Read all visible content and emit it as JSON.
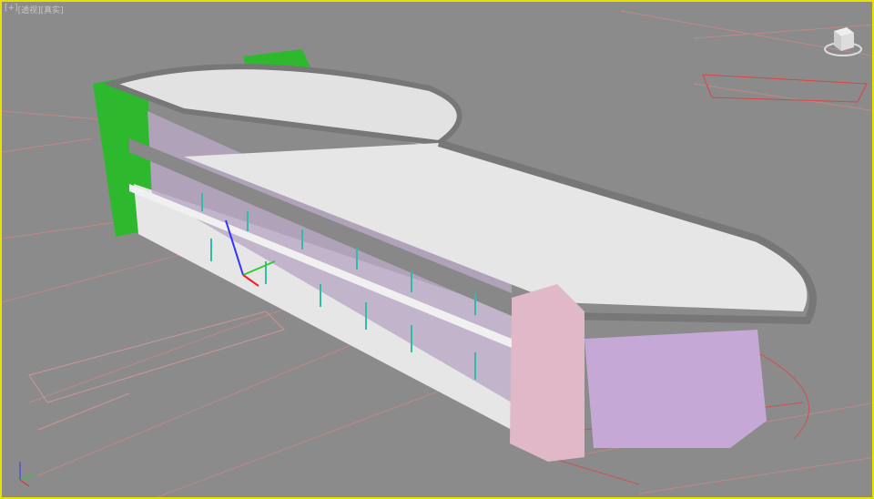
{
  "viewport": {
    "labels": [
      "[+]",
      "[透视]",
      "[真实]"
    ],
    "border_color": "#e8e000",
    "background": "#8b8b8b"
  },
  "icons": [
    "viewcube-icon",
    "transform-gizmo-icon",
    "world-axis-icon"
  ]
}
